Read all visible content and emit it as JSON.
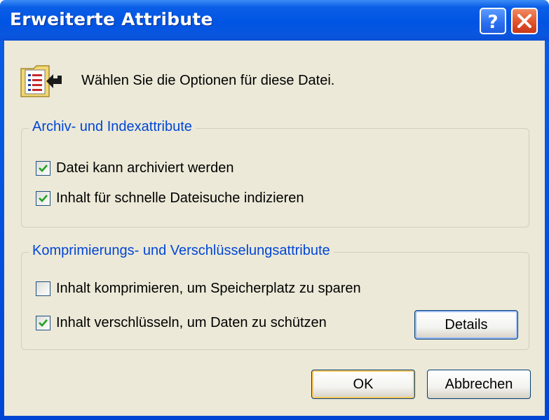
{
  "window": {
    "title": "Erweiterte Attribute",
    "help_label": "?",
    "close_label": "✕"
  },
  "prompt": "Wählen Sie die Optionen für diese Datei.",
  "groups": [
    {
      "legend": "Archiv- und Indexattribute",
      "options": [
        {
          "label": "Datei kann archiviert werden",
          "checked": true
        },
        {
          "label": "Inhalt für schnelle Dateisuche indizieren",
          "checked": true
        }
      ]
    },
    {
      "legend": "Komprimierungs- und Verschlüsselungsattribute",
      "options": [
        {
          "label": "Inhalt komprimieren, um Speicherplatz zu sparen",
          "checked": false
        },
        {
          "label": "Inhalt verschlüsseln, um Daten zu schützen",
          "checked": true
        }
      ],
      "details_label": "Details"
    }
  ],
  "buttons": {
    "ok": "OK",
    "cancel": "Abbrechen"
  },
  "colors": {
    "titlebar": "#0054e3",
    "client": "#ece9d8",
    "legend": "#0046d5",
    "check": "#21a121"
  }
}
